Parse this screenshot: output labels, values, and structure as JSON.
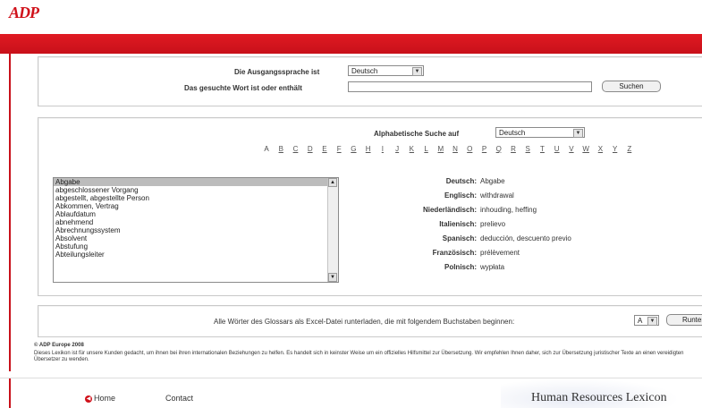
{
  "brand": {
    "logo_text": "ADP"
  },
  "search": {
    "source_label": "Die Ausgangssprache ist",
    "source_value": "Deutsch",
    "word_label": "Das gesuchte Wort ist oder enthält",
    "word_value": "",
    "search_button": "Suchen"
  },
  "alpha": {
    "label": "Alphabetische Suche auf",
    "language": "Deutsch",
    "letters": [
      "A",
      "B",
      "C",
      "D",
      "E",
      "F",
      "G",
      "H",
      "I",
      "J",
      "K",
      "L",
      "M",
      "N",
      "O",
      "P",
      "Q",
      "R",
      "S",
      "T",
      "U",
      "V",
      "W",
      "X",
      "Y",
      "Z"
    ]
  },
  "terms": [
    "Abgabe",
    "abgeschlossener Vorgang",
    "abgestellt, abgestellte Person",
    "Abkommen, Vertrag",
    "Ablaufdatum",
    "abnehmend",
    "Abrechnungssystem",
    "Absolvent",
    "Abstufung",
    "Abteilungsleiter"
  ],
  "translations": {
    "de_label": "Deutsch:",
    "de_value": "Abgabe",
    "en_label": "Englisch:",
    "en_value": "withdrawal",
    "nl_label": "Niederländisch:",
    "nl_value": "inhouding, heffing",
    "it_label": "Italienisch:",
    "it_value": "prelievo",
    "es_label": "Spanisch:",
    "es_value": "deducción, descuento previo",
    "fr_label": "Französisch:",
    "fr_value": "prélèvement",
    "pl_label": "Polnisch:",
    "pl_value": "wypłata"
  },
  "download": {
    "text": "Alle Wörter des Glossars als Excel-Datei runterladen, die mit folgendem Buchstaben beginnen:",
    "letter": "A",
    "button": "Runter"
  },
  "footer": {
    "copyright": "© ADP Europe 2008",
    "disclaimer": "Dieses Lexikon ist für unsere Kunden gedacht, um ihnen bei ihren internationalen Beziehungen zu helfen. Es handelt sich in keinster Weise um ein offizielles Hilfsmittel zur Übersetzung. Wir empfehlen Ihnen daher, sich zur Übersetzung juristischer Texte an einen vereidigten Übersetzer zu wenden.",
    "home": "Home",
    "contact": "Contact",
    "product": "Human Resources Lexicon"
  },
  "colors": {
    "accent": "#c8101a"
  }
}
